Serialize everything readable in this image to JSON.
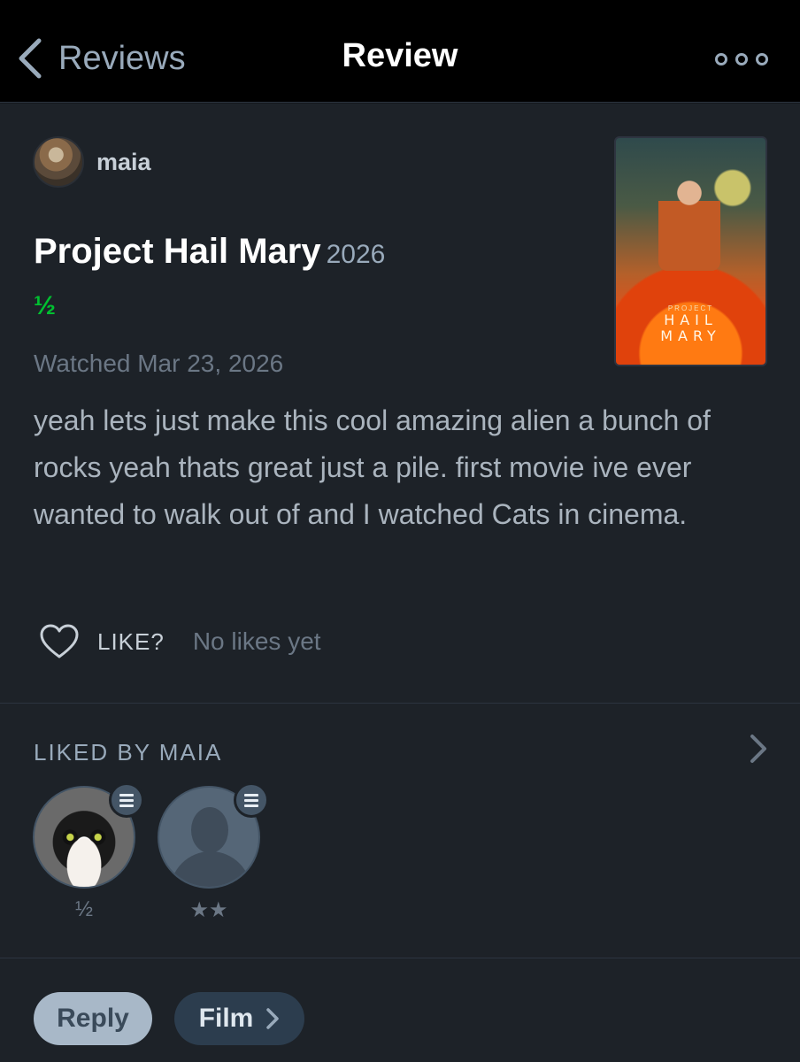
{
  "header": {
    "back_label": "Reviews",
    "title": "Review"
  },
  "review": {
    "author": "maia",
    "film_title": "Project Hail Mary",
    "film_year": "2026",
    "rating": "½",
    "watched": "Watched Mar 23, 2026",
    "text": "yeah lets just make this cool amazing alien a bunch of rocks yeah thats great just a pile. first movie ive ever wanted to walk out of and I watched Cats in cinema."
  },
  "poster": {
    "small_text": "PROJECT",
    "big_line1": "HAIL",
    "big_line2": "MARY"
  },
  "likes": {
    "like_label": "LIKE?",
    "count_text": "No likes yet"
  },
  "liked_by": {
    "header": "LIKED BY MAIA",
    "likers": [
      {
        "rating": "½"
      },
      {
        "rating": "★★"
      }
    ]
  },
  "actions": {
    "reply_label": "Reply",
    "film_label": "Film"
  },
  "colors": {
    "accent_green": "#00c030",
    "background": "#1d2228",
    "topbar": "#000000"
  }
}
